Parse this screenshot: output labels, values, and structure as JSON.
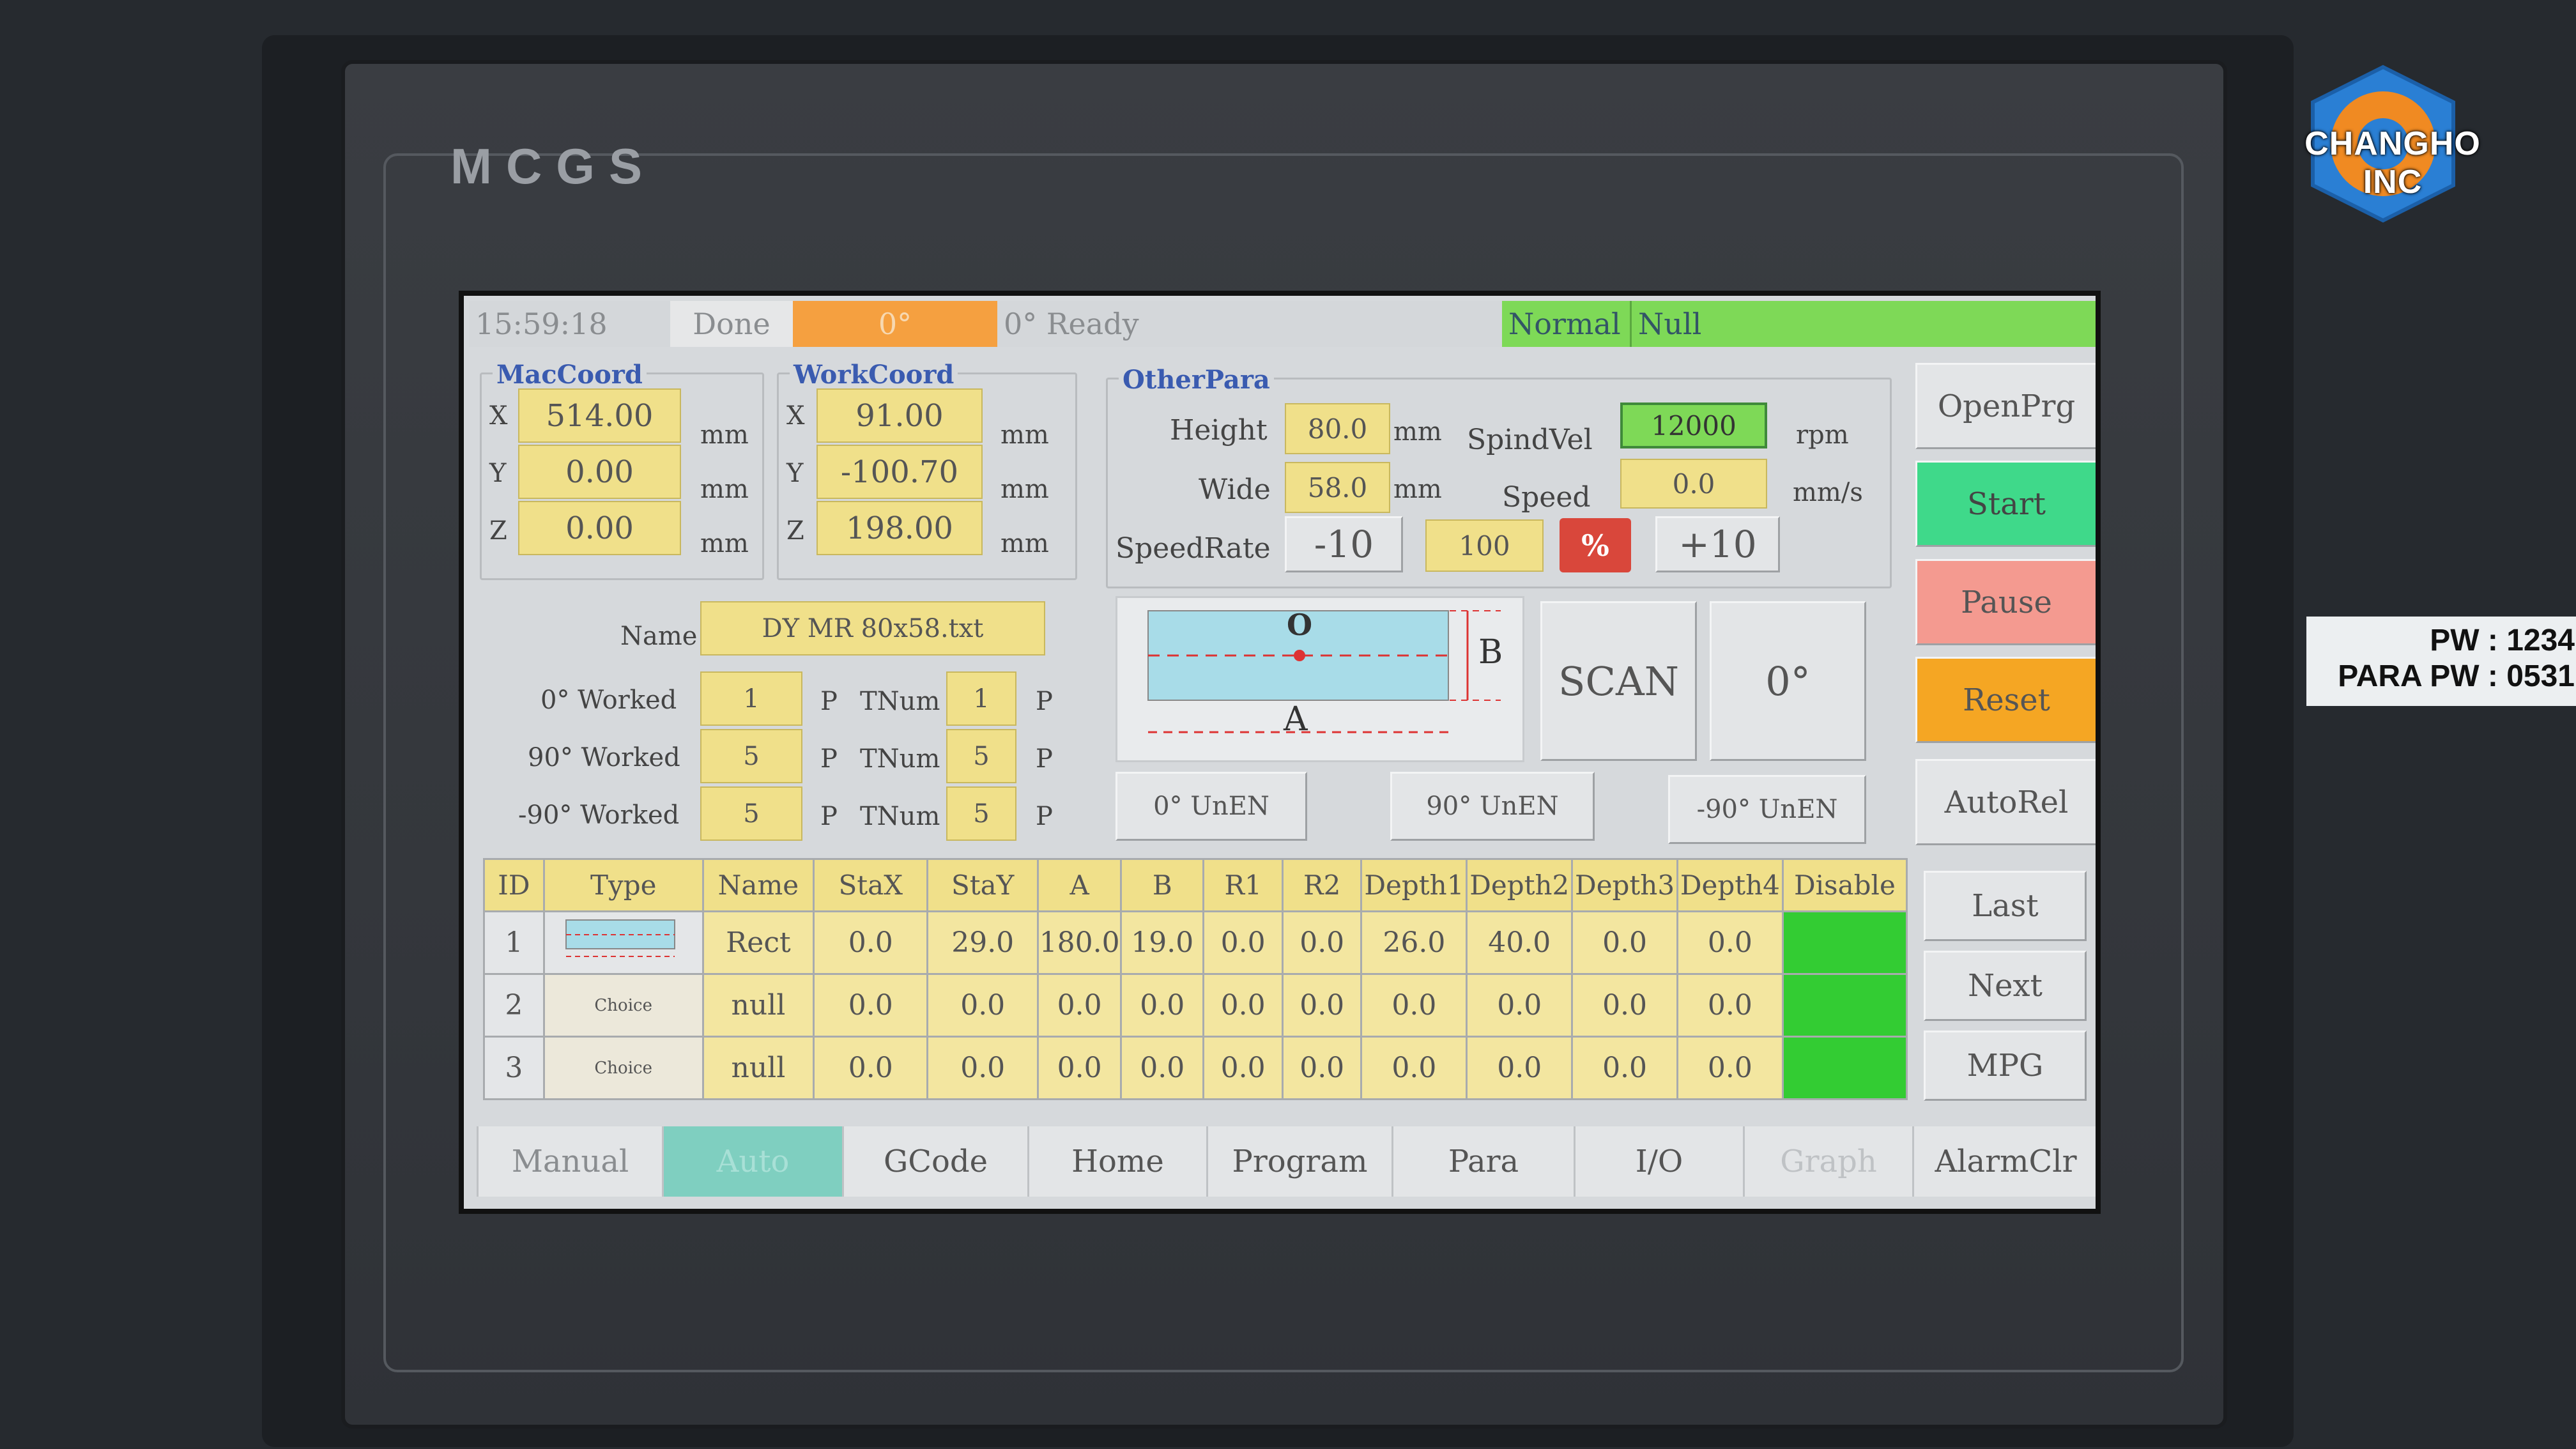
{
  "hardware": {
    "brand": "MCGS",
    "logo_text": "CHANGHO INC",
    "sticker_line1": "PW : 1234",
    "sticker_line2": "PARA PW : 0531"
  },
  "status": {
    "time": "15:59:18",
    "state": "Done",
    "angle": "0°",
    "message": "0° Ready",
    "mode": "Normal",
    "alarm": "Null"
  },
  "mac_coord": {
    "title": "MacCoord",
    "x": "514.00",
    "y": "0.00",
    "z": "0.00",
    "unit": "mm",
    "xl": "X",
    "yl": "Y",
    "zl": "Z"
  },
  "work_coord": {
    "title": "WorkCoord",
    "x": "91.00",
    "y": "-100.70",
    "z": "198.00",
    "unit": "mm",
    "xl": "X",
    "yl": "Y",
    "zl": "Z"
  },
  "other_para": {
    "title": "OtherPara",
    "height_label": "Height",
    "height": "80.0",
    "height_unit": "mm",
    "wide_label": "Wide",
    "wide": "58.0",
    "wide_unit": "mm",
    "spindvel_label": "SpindVel",
    "spindvel": "12000",
    "spindvel_unit": "rpm",
    "speed_label": "Speed",
    "speed": "0.0",
    "speed_unit": "mm/s",
    "speedrate_label": "SpeedRate",
    "minus": "-10",
    "rate": "100",
    "percent": "%",
    "plus": "+10"
  },
  "job": {
    "name_label": "Name",
    "name": "DY MR 80x58.txt",
    "w0_label": "0° Worked",
    "w0": "1",
    "t0": "1",
    "w90_label": "90° Worked",
    "w90": "5",
    "t90": "5",
    "wm90_label": "-90° Worked",
    "wm90": "5",
    "tm90": "5",
    "p": "P",
    "tnum": "TNum"
  },
  "diagram": {
    "o": "O",
    "a": "A",
    "b": "B"
  },
  "scan_button": "SCAN",
  "angle_button": "0°",
  "unen": {
    "u0": "0° UnEN",
    "u90": "90° UnEN",
    "um90": "-90° UnEN"
  },
  "side_buttons": {
    "openprg": "OpenPrg",
    "start": "Start",
    "pause": "Pause",
    "reset": "Reset",
    "autorel": "AutoRel",
    "last": "Last",
    "next": "Next",
    "mpg": "MPG"
  },
  "table": {
    "headers": [
      "ID",
      "Type",
      "Name",
      "StaX",
      "StaY",
      "A",
      "B",
      "R1",
      "R2",
      "Depth1",
      "Depth2",
      "Depth3",
      "Depth4",
      "Disable"
    ],
    "rows": [
      {
        "id": "1",
        "type": "",
        "name": "Rect",
        "stax": "0.0",
        "stay": "29.0",
        "a": "180.0",
        "b": "19.0",
        "r1": "0.0",
        "r2": "0.0",
        "d1": "26.0",
        "d2": "40.0",
        "d3": "0.0",
        "d4": "0.0"
      },
      {
        "id": "2",
        "type": "Choice",
        "name": "null",
        "stax": "0.0",
        "stay": "0.0",
        "a": "0.0",
        "b": "0.0",
        "r1": "0.0",
        "r2": "0.0",
        "d1": "0.0",
        "d2": "0.0",
        "d3": "0.0",
        "d4": "0.0"
      },
      {
        "id": "3",
        "type": "Choice",
        "name": "null",
        "stax": "0.0",
        "stay": "0.0",
        "a": "0.0",
        "b": "0.0",
        "r1": "0.0",
        "r2": "0.0",
        "d1": "0.0",
        "d2": "0.0",
        "d3": "0.0",
        "d4": "0.0"
      }
    ]
  },
  "tabs": [
    "Manual",
    "Auto",
    "GCode",
    "Home",
    "Program",
    "Para",
    "I/O",
    "Graph",
    "AlarmClr"
  ],
  "colors": {
    "yellow_cell": "#f0e08a",
    "start_green": "#3fd98a",
    "pause_pink": "#f49a90",
    "reset_orange": "#f5a623",
    "status_green": "#7ed957",
    "status_orange": "#f5a040",
    "percent_red": "#d9473b",
    "auto_tab": "#7fcfc0"
  }
}
